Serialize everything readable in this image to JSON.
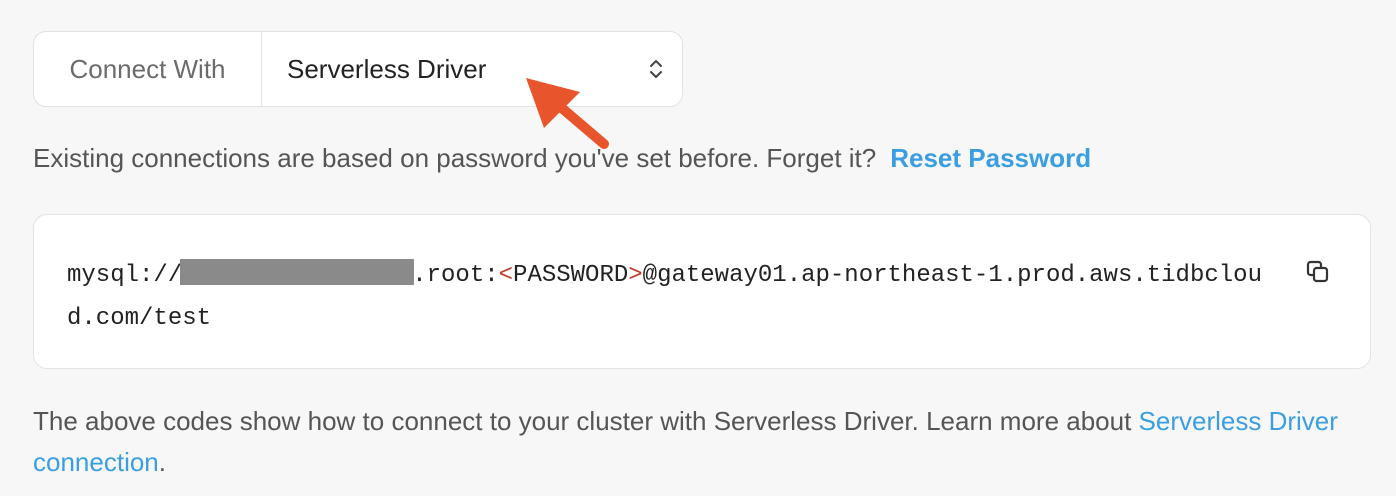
{
  "connect": {
    "label": "Connect With",
    "selected": "Serverless Driver"
  },
  "password_notice": {
    "text": "Existing connections are based on password you've set before. Forget it?",
    "reset_link": "Reset Password"
  },
  "connection_string": {
    "prefix": "mysql://",
    "mid": ".root:",
    "open_bracket": "<",
    "password_placeholder": "PASSWORD",
    "close_bracket": ">",
    "host": "@gateway01.ap-northeast-1.prod.aws.tidbcloud.com/test"
  },
  "note": {
    "text": "The above codes show how to connect to your cluster with Serverless Driver. Learn more about ",
    "link": "Serverless Driver connection",
    "suffix": "."
  },
  "icons": {
    "select": "chevron-up-down-icon",
    "copy": "copy-icon",
    "annotation": "annotation-arrow"
  },
  "colors": {
    "link": "#3b9ee0",
    "annotation_arrow": "#e8542c",
    "password_bracket": "#c0392b",
    "redaction": "#8a8a8a"
  }
}
